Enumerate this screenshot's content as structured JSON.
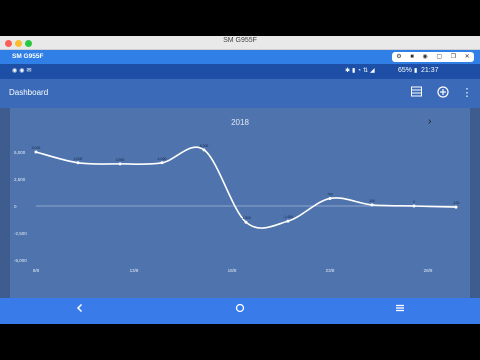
{
  "window": {
    "title": "SM G955F"
  },
  "device_bar": {
    "title": "SM G955F"
  },
  "status_bar": {
    "battery": "65%",
    "time": "21:37"
  },
  "app_bar": {
    "title": "Dashboard",
    "icons": [
      "table-icon",
      "add-circle-icon",
      "more-vert-icon"
    ]
  },
  "chart_data": {
    "type": "line",
    "title": "2018",
    "x_tick_labels": [
      "8/8",
      "13/8",
      "18/8",
      "23/8",
      "28/8"
    ],
    "y_tick_labels": [
      "5,000",
      "2,500",
      "0",
      "-2,500",
      "-5,000"
    ],
    "ylim": [
      -5000,
      5000
    ],
    "y_ticks": [
      5000,
      2500,
      0,
      -2500,
      -5000
    ],
    "x_index_range": [
      0,
      10
    ],
    "points": [
      {
        "i": 0,
        "value": 5000,
        "label": "5,000"
      },
      {
        "i": 1,
        "value": 4000,
        "label": "4,000"
      },
      {
        "i": 2,
        "value": 3900,
        "label": "3,900"
      },
      {
        "i": 3,
        "value": 4000,
        "label": "4,000"
      },
      {
        "i": 4,
        "value": 5200,
        "label": "5,200"
      },
      {
        "i": 5,
        "value": -1500,
        "label": "-1,500"
      },
      {
        "i": 6,
        "value": -1400,
        "label": "-1,400"
      },
      {
        "i": 7,
        "value": 700,
        "label": "700"
      },
      {
        "i": 8,
        "value": 100,
        "label": "100"
      },
      {
        "i": 9,
        "value": 0,
        "label": "0"
      },
      {
        "i": 10,
        "value": -100,
        "label": "-100"
      }
    ],
    "line_color": "#ffffff",
    "grid": false
  },
  "colors": {
    "status_bar": "#1c4fa5",
    "app_bar": "#3a6ab8",
    "nav_bar": "#3a7bea",
    "chart_bg": "#4f74ad"
  }
}
